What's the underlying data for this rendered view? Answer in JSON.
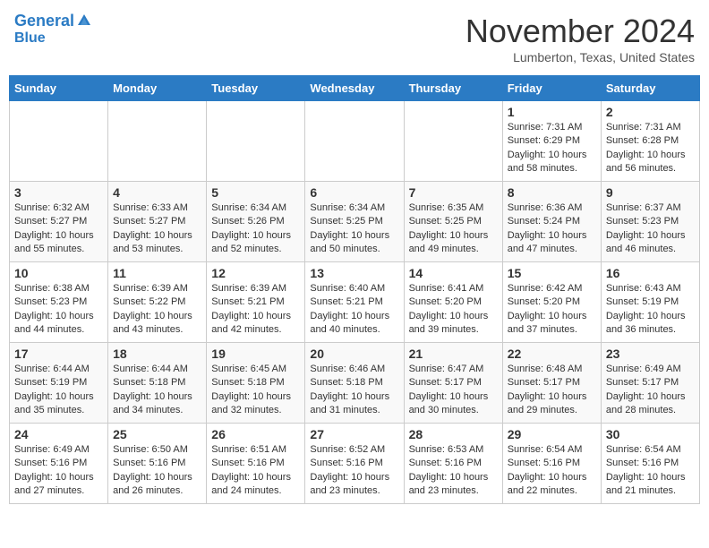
{
  "header": {
    "logo_line1": "General",
    "logo_line2": "Blue",
    "month": "November 2024",
    "location": "Lumberton, Texas, United States"
  },
  "days_of_week": [
    "Sunday",
    "Monday",
    "Tuesday",
    "Wednesday",
    "Thursday",
    "Friday",
    "Saturday"
  ],
  "weeks": [
    [
      {
        "day": "",
        "data": ""
      },
      {
        "day": "",
        "data": ""
      },
      {
        "day": "",
        "data": ""
      },
      {
        "day": "",
        "data": ""
      },
      {
        "day": "",
        "data": ""
      },
      {
        "day": "1",
        "data": "Sunrise: 7:31 AM\nSunset: 6:29 PM\nDaylight: 10 hours\nand 58 minutes."
      },
      {
        "day": "2",
        "data": "Sunrise: 7:31 AM\nSunset: 6:28 PM\nDaylight: 10 hours\nand 56 minutes."
      }
    ],
    [
      {
        "day": "3",
        "data": "Sunrise: 6:32 AM\nSunset: 5:27 PM\nDaylight: 10 hours\nand 55 minutes."
      },
      {
        "day": "4",
        "data": "Sunrise: 6:33 AM\nSunset: 5:27 PM\nDaylight: 10 hours\nand 53 minutes."
      },
      {
        "day": "5",
        "data": "Sunrise: 6:34 AM\nSunset: 5:26 PM\nDaylight: 10 hours\nand 52 minutes."
      },
      {
        "day": "6",
        "data": "Sunrise: 6:34 AM\nSunset: 5:25 PM\nDaylight: 10 hours\nand 50 minutes."
      },
      {
        "day": "7",
        "data": "Sunrise: 6:35 AM\nSunset: 5:25 PM\nDaylight: 10 hours\nand 49 minutes."
      },
      {
        "day": "8",
        "data": "Sunrise: 6:36 AM\nSunset: 5:24 PM\nDaylight: 10 hours\nand 47 minutes."
      },
      {
        "day": "9",
        "data": "Sunrise: 6:37 AM\nSunset: 5:23 PM\nDaylight: 10 hours\nand 46 minutes."
      }
    ],
    [
      {
        "day": "10",
        "data": "Sunrise: 6:38 AM\nSunset: 5:23 PM\nDaylight: 10 hours\nand 44 minutes."
      },
      {
        "day": "11",
        "data": "Sunrise: 6:39 AM\nSunset: 5:22 PM\nDaylight: 10 hours\nand 43 minutes."
      },
      {
        "day": "12",
        "data": "Sunrise: 6:39 AM\nSunset: 5:21 PM\nDaylight: 10 hours\nand 42 minutes."
      },
      {
        "day": "13",
        "data": "Sunrise: 6:40 AM\nSunset: 5:21 PM\nDaylight: 10 hours\nand 40 minutes."
      },
      {
        "day": "14",
        "data": "Sunrise: 6:41 AM\nSunset: 5:20 PM\nDaylight: 10 hours\nand 39 minutes."
      },
      {
        "day": "15",
        "data": "Sunrise: 6:42 AM\nSunset: 5:20 PM\nDaylight: 10 hours\nand 37 minutes."
      },
      {
        "day": "16",
        "data": "Sunrise: 6:43 AM\nSunset: 5:19 PM\nDaylight: 10 hours\nand 36 minutes."
      }
    ],
    [
      {
        "day": "17",
        "data": "Sunrise: 6:44 AM\nSunset: 5:19 PM\nDaylight: 10 hours\nand 35 minutes."
      },
      {
        "day": "18",
        "data": "Sunrise: 6:44 AM\nSunset: 5:18 PM\nDaylight: 10 hours\nand 34 minutes."
      },
      {
        "day": "19",
        "data": "Sunrise: 6:45 AM\nSunset: 5:18 PM\nDaylight: 10 hours\nand 32 minutes."
      },
      {
        "day": "20",
        "data": "Sunrise: 6:46 AM\nSunset: 5:18 PM\nDaylight: 10 hours\nand 31 minutes."
      },
      {
        "day": "21",
        "data": "Sunrise: 6:47 AM\nSunset: 5:17 PM\nDaylight: 10 hours\nand 30 minutes."
      },
      {
        "day": "22",
        "data": "Sunrise: 6:48 AM\nSunset: 5:17 PM\nDaylight: 10 hours\nand 29 minutes."
      },
      {
        "day": "23",
        "data": "Sunrise: 6:49 AM\nSunset: 5:17 PM\nDaylight: 10 hours\nand 28 minutes."
      }
    ],
    [
      {
        "day": "24",
        "data": "Sunrise: 6:49 AM\nSunset: 5:16 PM\nDaylight: 10 hours\nand 27 minutes."
      },
      {
        "day": "25",
        "data": "Sunrise: 6:50 AM\nSunset: 5:16 PM\nDaylight: 10 hours\nand 26 minutes."
      },
      {
        "day": "26",
        "data": "Sunrise: 6:51 AM\nSunset: 5:16 PM\nDaylight: 10 hours\nand 24 minutes."
      },
      {
        "day": "27",
        "data": "Sunrise: 6:52 AM\nSunset: 5:16 PM\nDaylight: 10 hours\nand 23 minutes."
      },
      {
        "day": "28",
        "data": "Sunrise: 6:53 AM\nSunset: 5:16 PM\nDaylight: 10 hours\nand 23 minutes."
      },
      {
        "day": "29",
        "data": "Sunrise: 6:54 AM\nSunset: 5:16 PM\nDaylight: 10 hours\nand 22 minutes."
      },
      {
        "day": "30",
        "data": "Sunrise: 6:54 AM\nSunset: 5:16 PM\nDaylight: 10 hours\nand 21 minutes."
      }
    ]
  ]
}
